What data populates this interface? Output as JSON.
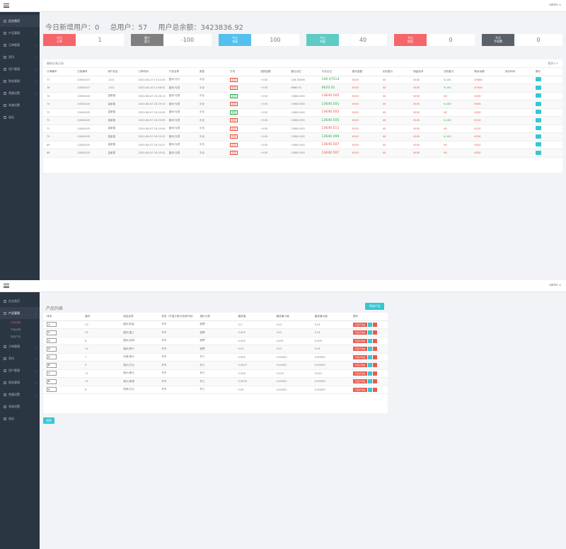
{
  "header": {
    "user": "admin ∨"
  },
  "sidebar1": [
    {
      "label": "后台首页",
      "active": true
    },
    {
      "label": "产品管理"
    },
    {
      "label": "订单管理"
    },
    {
      "label": "资讯"
    },
    {
      "label": "用户管理"
    },
    {
      "label": "财务管理"
    },
    {
      "label": "常量设置"
    },
    {
      "label": "系统设置"
    },
    {
      "label": "退出"
    }
  ],
  "sidebar2": {
    "items": [
      {
        "label": "后台首页"
      },
      {
        "label": "产品管理",
        "open": true
      },
      {
        "label": "订单管理"
      },
      {
        "label": "资讯"
      },
      {
        "label": "用户管理"
      },
      {
        "label": "财务管理"
      },
      {
        "label": "常量设置"
      },
      {
        "label": "系统设置"
      },
      {
        "label": "退出"
      }
    ],
    "subitems": [
      "产品列表",
      "产品分类",
      "添加产品"
    ]
  },
  "stats_title": {
    "new_users": "今日新增用户：0",
    "total_users": "总用户：57",
    "total_balance": "用户总余额：3423836.92"
  },
  "stats": [
    {
      "label": "今日\n订单",
      "value": "1",
      "color": "#f4666a"
    },
    {
      "label": "客户\n盈亏",
      "value": "-100",
      "color": "#7f7f7f"
    },
    {
      "label": "今日\n充值",
      "value": "100",
      "color": "#54c0ef"
    },
    {
      "label": "今日\n充值",
      "value": "40",
      "color": "#5fcac6"
    },
    {
      "label": "今日\n提现",
      "value": "0",
      "color": "#f4666a"
    },
    {
      "label": "今天\n手续费",
      "value": "0",
      "color": "#5a6168"
    }
  ],
  "orders_card": {
    "title": "最新交易记录",
    "more": "更多>>",
    "columns": [
      "订单编号",
      "交易编号",
      "用户姓名",
      "订单时间",
      "产品名称",
      "类型",
      "方向",
      "涨跌金额",
      "建仓点位",
      "平仓点位",
      "委托金额",
      "实际盈亏",
      "佣金成本",
      "实际盈亏",
      "剩余余额",
      "持仓时间",
      "操作"
    ],
    "rows": [
      [
        "77",
        "10004107",
        "-3.01",
        "2020-08-27 17:23:30",
        "盈利/亏分",
        "平仓",
        "买涨",
        "+100",
        "106.33006",
        "106.07514",
        "¥100",
        "40",
        "¥100",
        "¥-100",
        "¥7860",
        ""
      ],
      [
        "76",
        "10004107",
        "-3.01",
        "2020-08-10 11:46:51",
        "盈利/亏损",
        "平仓",
        "买涨",
        "+100",
        "6686.91",
        "6620.01",
        "¥100",
        "40",
        "¥100",
        "¥-100",
        "¥7450",
        ""
      ],
      [
        "75",
        "10004105",
        "温家善",
        "2020-08-07 20:23:13",
        "盈利/亏损",
        "平仓",
        "买涨",
        "+100",
        "13640.505",
        "13640.505",
        "¥100",
        "40",
        "¥100",
        "¥0",
        "¥230",
        ""
      ],
      [
        "74",
        "10004105",
        "温家善",
        "2020-08-07 20:25:13",
        "盈利/亏损",
        "平仓",
        "买涨",
        "+100",
        "13640.505",
        "13640.501",
        "¥100",
        "40",
        "¥100",
        "¥-100",
        "¥230",
        ""
      ],
      [
        "73",
        "10004105",
        "温家善",
        "2020-08-07 20:25:09",
        "盈利/亏损",
        "平仓",
        "买涨",
        "+100",
        "13640.404",
        "13640.502",
        "¥100",
        "40",
        "¥100",
        "¥0",
        "¥230",
        ""
      ],
      [
        "72",
        "10004105",
        "温家善",
        "2020-08-07 20:25:05",
        "盈利/亏损",
        "平仓",
        "买涨",
        "+100",
        "13640.505",
        "13640.505",
        "¥100",
        "40",
        "¥100",
        "¥-100",
        "¥210",
        ""
      ],
      [
        "71",
        "10004105",
        "温家善",
        "2020-08-07 20:23:40",
        "盈利/亏损",
        "平仓",
        "买涨",
        "+100",
        "13640.503",
        "13640.511",
        "¥100",
        "40",
        "¥100",
        "¥0",
        "¥120",
        ""
      ],
      [
        "70",
        "10004105",
        "温家善",
        "2020-08-07 20:23:31",
        "盈利/亏损",
        "平仓",
        "买涨",
        "+100",
        "13640.502",
        "13640.499",
        "¥100",
        "40",
        "¥100",
        "¥-100",
        "¥230",
        ""
      ],
      [
        "69",
        "10004105",
        "温家善",
        "2020-08-07 20:23:27",
        "盈利/亏损",
        "平仓",
        "买涨",
        "+100",
        "13640.505",
        "13640.507",
        "¥100",
        "40",
        "¥100",
        "¥0",
        "¥320",
        ""
      ],
      [
        "68",
        "10004105",
        "温家善",
        "2020-08-07 20:23:31",
        "盈利/亏损",
        "平仓",
        "买涨",
        "+100",
        "13640.505",
        "13640.507",
        "¥100",
        "40",
        "¥100",
        "¥0",
        "¥320",
        ""
      ]
    ],
    "green_flags": [
      true,
      true,
      false,
      true,
      false,
      true,
      false,
      true,
      false,
      false
    ]
  },
  "products": {
    "title": "产品列表",
    "add_button": "添加产品",
    "sort_button": "排序",
    "columns": [
      "排序",
      "编号",
      "商品名称",
      "状态（不显示表示关闭时间）",
      "报价分类",
      "最低值",
      "最低最小值",
      "最低最大值",
      "操作"
    ],
    "op_label": "已显示状态",
    "rows": [
      [
        "1",
        "23",
        "盈利/转金",
        "开市",
        "股票",
        "0.5",
        "0.01",
        "0.01"
      ],
      [
        "2",
        "25",
        "盈利/重工",
        "开市",
        "股票",
        "0.005",
        "0.01",
        "0.01"
      ],
      [
        "3",
        "8",
        "盈利/百奥",
        "开市",
        "股票",
        "0.005",
        "0.001",
        "0.005"
      ],
      [
        "4",
        "24",
        "盈利/燃气",
        "开市",
        "股票",
        "0.01",
        "0.01",
        "0.01"
      ],
      [
        "5",
        "7",
        "利弗/美元",
        "开市",
        "外汇",
        "0.003",
        "0.00001",
        "0.00003"
      ],
      [
        "6",
        "9",
        "美元/日元",
        "开市",
        "外汇",
        "0.0007",
        "0.00001",
        "0.00003"
      ],
      [
        "7",
        "17",
        "美元/美元",
        "开市",
        "外汇",
        "0.016",
        "0.010",
        "0.010"
      ],
      [
        "8",
        "11",
        "美元/英镑",
        "开市",
        "外汇",
        "0.0070",
        "0.00001",
        "0.00003"
      ],
      [
        "9",
        "6",
        "英镑/日元",
        "开市",
        "外汇",
        "0.05",
        "0.00001",
        "0.00003"
      ]
    ]
  }
}
